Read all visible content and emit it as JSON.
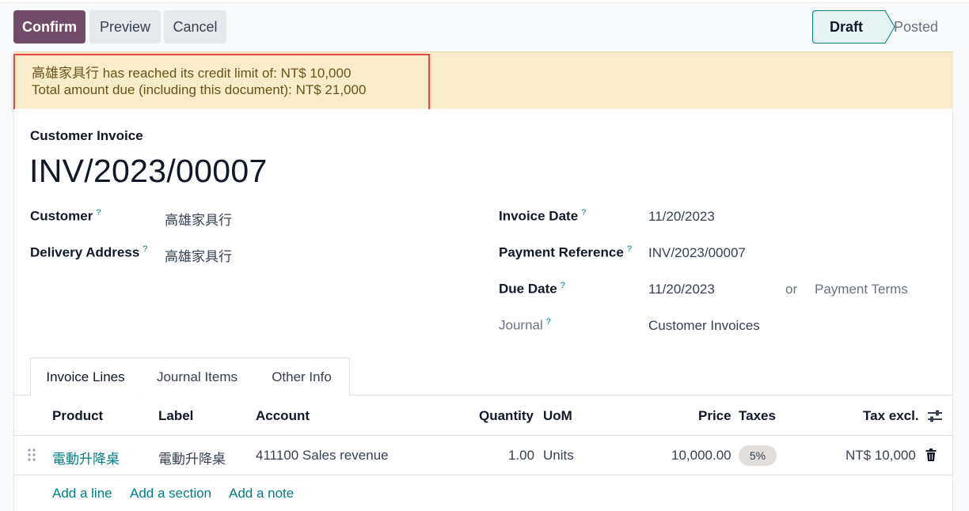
{
  "toolbar": {
    "confirm_label": "Confirm",
    "preview_label": "Preview",
    "cancel_label": "Cancel"
  },
  "status": {
    "stages": [
      "Draft",
      "Posted"
    ],
    "current": "Draft"
  },
  "alert": {
    "line1": "高雄家具行 has reached its credit limit of: NT$ 10,000",
    "line2": "Total amount due (including this document): NT$ 21,000"
  },
  "invoice": {
    "type_label": "Customer Invoice",
    "name": "INV/2023/00007",
    "fields": {
      "customer_label": "Customer",
      "customer_value": "高雄家具行",
      "delivery_label": "Delivery Address",
      "delivery_value": "高雄家具行",
      "invoice_date_label": "Invoice Date",
      "invoice_date_value": "11/20/2023",
      "payment_ref_label": "Payment Reference",
      "payment_ref_value": "INV/2023/00007",
      "due_date_label": "Due Date",
      "due_date_value": "11/20/2023",
      "or_label": "or",
      "payment_terms_placeholder": "Payment Terms",
      "journal_label": "Journal",
      "journal_value": "Customer Invoices"
    },
    "help_mark": "?"
  },
  "tabs": [
    {
      "label": "Invoice Lines",
      "active": true
    },
    {
      "label": "Journal Items",
      "active": false
    },
    {
      "label": "Other Info",
      "active": false
    }
  ],
  "lines_table": {
    "headers": {
      "product": "Product",
      "label": "Label",
      "account": "Account",
      "quantity": "Quantity",
      "uom": "UoM",
      "price": "Price",
      "taxes": "Taxes",
      "tax_excl": "Tax excl."
    },
    "rows": [
      {
        "product": "電動升降桌",
        "label": "電動升降桌",
        "account": "411100 Sales revenue",
        "quantity": "1.00",
        "uom": "Units",
        "price": "10,000.00",
        "taxes": "5%",
        "tax_excl": "NT$ 10,000"
      }
    ],
    "actions": {
      "add_line": "Add a line",
      "add_section": "Add a section",
      "add_note": "Add a note"
    }
  },
  "colors": {
    "primary": "#714b67",
    "accent": "#017e84",
    "alert_bg": "#f8ecc9",
    "highlight": "#e54848"
  },
  "icons": {
    "drag_handle": "drag-handle-icon",
    "column_settings": "sliders-icon",
    "delete": "trash-icon"
  }
}
